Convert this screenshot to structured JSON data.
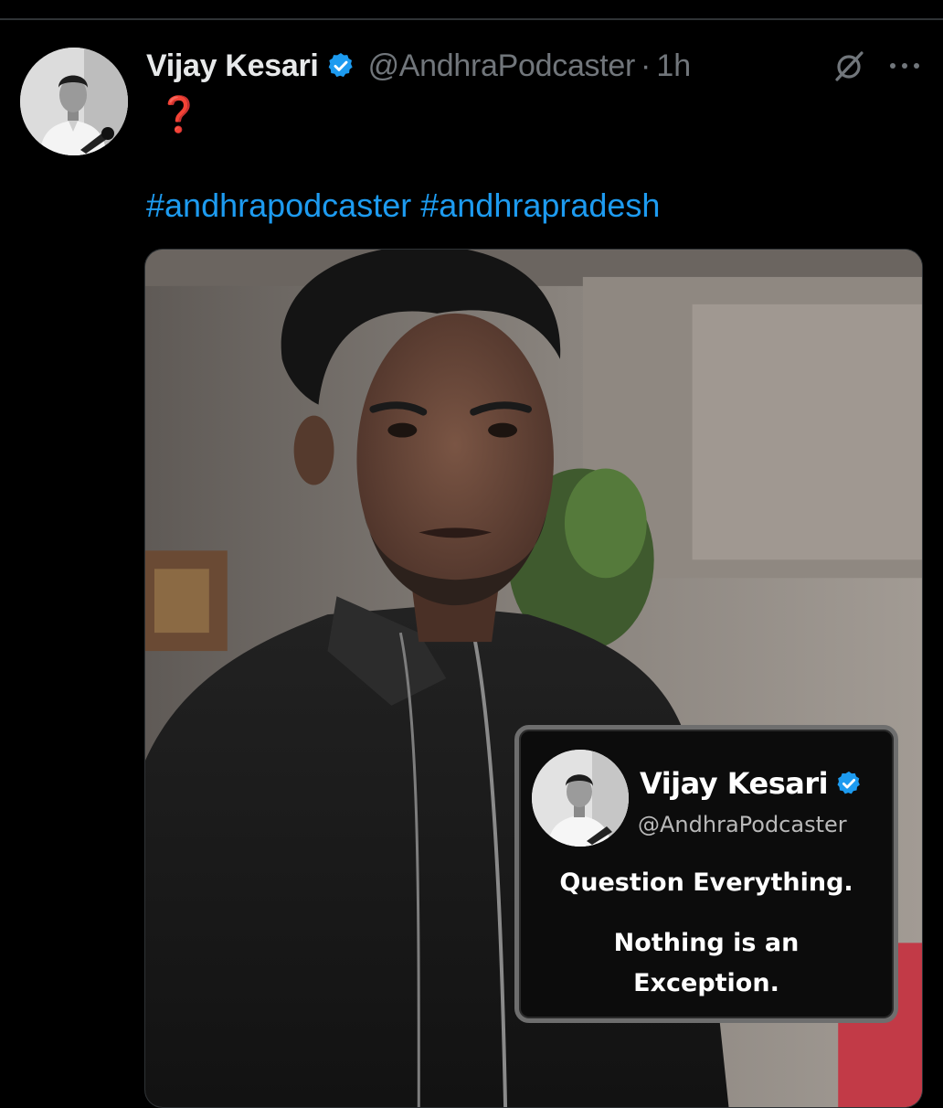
{
  "colors": {
    "background": "#000000",
    "text_primary": "#e7e9ea",
    "text_secondary": "#71767b",
    "link": "#1d9bf0",
    "verified": "#1d9bf0",
    "question_mark": "#e0202a"
  },
  "tweet": {
    "author": {
      "name": "Vijay Kesari",
      "handle": "@AndhraPodcaster",
      "verified": true
    },
    "separator": "·",
    "time": "1h",
    "text_emoji": "❓",
    "hashtags": [
      "#andhrapodcaster",
      "#andhrapradesh"
    ],
    "icons": {
      "grok": "grok-slash-circle-icon",
      "more": "more-horizontal-icon"
    }
  },
  "media": {
    "quote_card": {
      "name": "Vijay Kesari",
      "handle": "@AndhraPodcaster",
      "line1": "Question Everything.",
      "line2a": "Nothing is an",
      "line2b": "Exception."
    }
  }
}
